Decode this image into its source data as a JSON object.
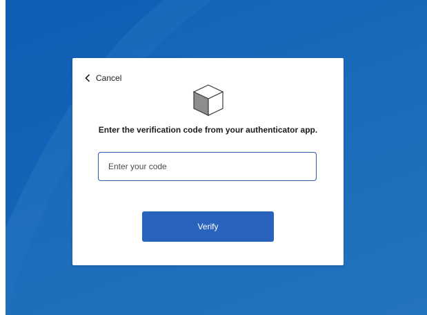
{
  "card": {
    "cancel_label": "Cancel",
    "prompt": "Enter the verification code from your authenticator app.",
    "code_input": {
      "value": "",
      "placeholder": "Enter your code"
    },
    "verify_label": "Verify"
  },
  "icons": {
    "back": "chevron-left-icon",
    "illustration": "cube-icon"
  },
  "colors": {
    "background": "#1b6bbb",
    "input_border": "#2a5aa8",
    "button": "#2a63be",
    "card": "#ffffff"
  }
}
